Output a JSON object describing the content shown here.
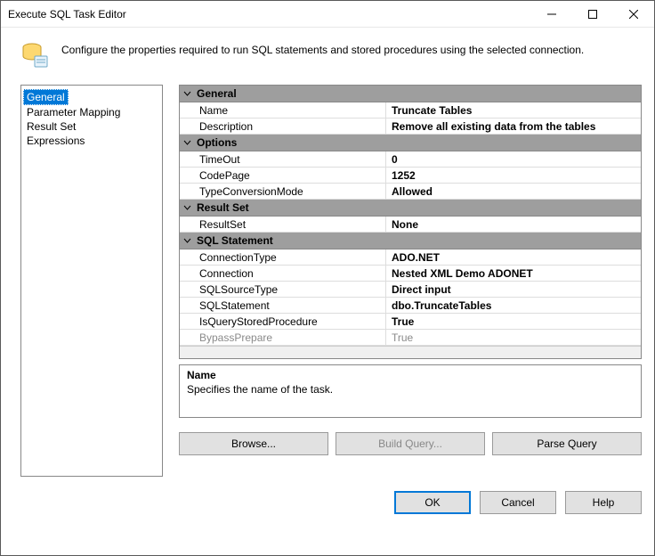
{
  "window": {
    "title": "Execute SQL Task Editor"
  },
  "header": {
    "text": "Configure the properties required to run SQL statements and stored procedures using the selected connection."
  },
  "nav": {
    "items": [
      {
        "label": "General",
        "selected": true
      },
      {
        "label": "Parameter Mapping",
        "selected": false
      },
      {
        "label": "Result Set",
        "selected": false
      },
      {
        "label": "Expressions",
        "selected": false
      }
    ]
  },
  "sections": [
    {
      "title": "General",
      "rows": [
        {
          "label": "Name",
          "value": "Truncate Tables"
        },
        {
          "label": "Description",
          "value": "Remove all existing data from the tables"
        }
      ]
    },
    {
      "title": "Options",
      "rows": [
        {
          "label": "TimeOut",
          "value": "0"
        },
        {
          "label": "CodePage",
          "value": "1252"
        },
        {
          "label": "TypeConversionMode",
          "value": "Allowed"
        }
      ]
    },
    {
      "title": "Result Set",
      "rows": [
        {
          "label": "ResultSet",
          "value": "None"
        }
      ]
    },
    {
      "title": "SQL Statement",
      "rows": [
        {
          "label": "ConnectionType",
          "value": "ADO.NET"
        },
        {
          "label": "Connection",
          "value": "Nested XML Demo ADONET"
        },
        {
          "label": "SQLSourceType",
          "value": "Direct input"
        },
        {
          "label": "SQLStatement",
          "value": "dbo.TruncateTables"
        },
        {
          "label": "IsQueryStoredProcedure",
          "value": "True"
        },
        {
          "label": "BypassPrepare",
          "value": "True",
          "disabled": true
        }
      ]
    }
  ],
  "description": {
    "title": "Name",
    "text": "Specifies the name of the task."
  },
  "actions": {
    "browse": "Browse...",
    "build": "Build Query...",
    "parse": "Parse Query"
  },
  "footer": {
    "ok": "OK",
    "cancel": "Cancel",
    "help": "Help"
  }
}
